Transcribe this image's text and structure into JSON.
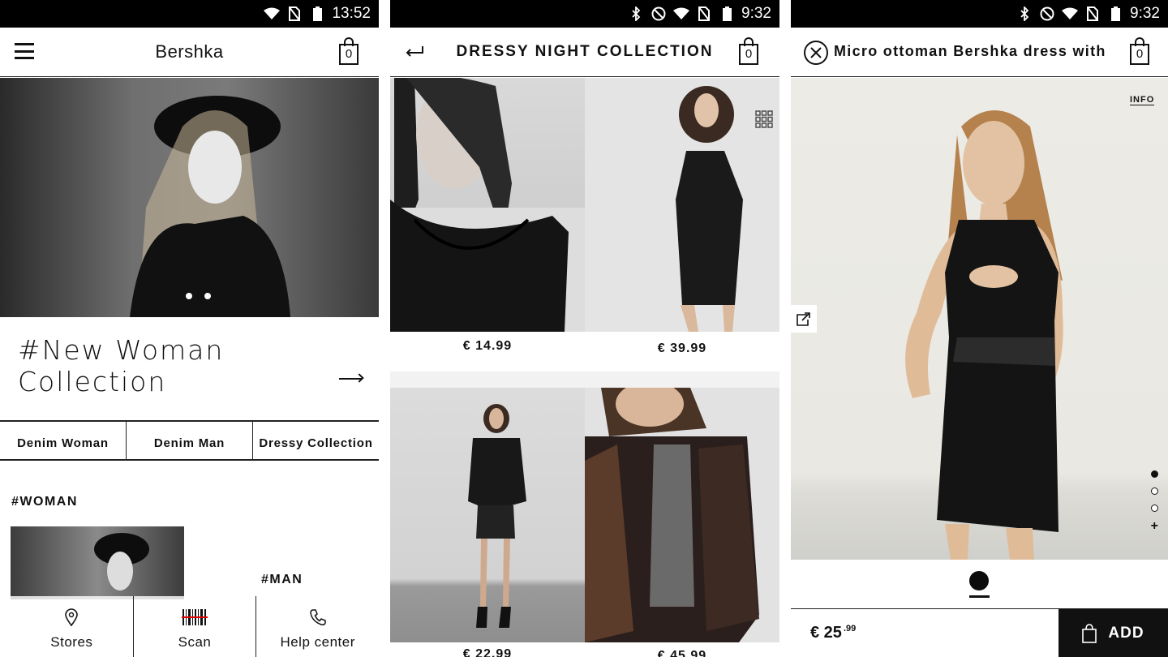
{
  "screen1": {
    "status_time": "13:52",
    "app_title": "Bershka",
    "cart_count": "0",
    "hero_title": "#New Woman Collection",
    "categories": [
      "Denim Woman",
      "Denim Man",
      "Dressy Collection"
    ],
    "section_woman": "#WOMAN",
    "section_man": "#MAN",
    "nav": [
      "Stores",
      "Scan",
      "Help center"
    ]
  },
  "screen2": {
    "status_time": "9:32",
    "title": "DRESSY NIGHT COLLECTION",
    "cart_count": "0",
    "prices": [
      "€ 14.99",
      "€ 39.99",
      "€ 22.99",
      "€ 45.99"
    ]
  },
  "screen3": {
    "status_time": "9:32",
    "title": "Micro ottoman Bershka dress with st",
    "cart_count": "0",
    "info_label": "INFO",
    "price_main": "€ 25",
    "price_cents": ".99",
    "add_label": "ADD"
  }
}
